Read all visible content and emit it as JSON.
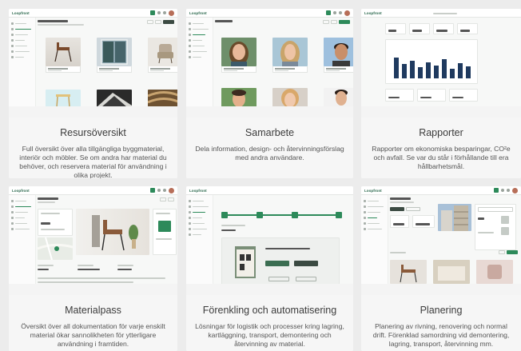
{
  "cards": [
    {
      "title": "Resursöversikt",
      "desc": "Full översikt över alla tillgängliga byggmaterial, interiör och möbler. Se om andra har material du behöver, och reservera material för användning i olika projekt."
    },
    {
      "title": "Samarbete",
      "desc": "Dela information, design- och återvinningsförslag med andra användare."
    },
    {
      "title": "Rapporter",
      "desc": "Rapporter om ekonomiska besparingar, CO²e och avfall. Se var du står i förhållande till era hållbarhetsmål."
    },
    {
      "title": "Materialpass",
      "desc": "Översikt över all dokumentation för varje enskilt material ökar sannolikheten för ytterligare användning i framtiden."
    },
    {
      "title": "Förenkling och automatisering",
      "desc": "Lösningar för logistik och processer kring lagring, kartläggning, transport, demontering och återvinning av material."
    },
    {
      "title": "Planering",
      "desc": "Planering av rivning, renovering och normal drift. Förenklad samordning vid demontering, lagring, transport, återvinning mm."
    }
  ],
  "app": {
    "logo": "Loopfront"
  },
  "colors": {
    "brand": "#2d8a5a",
    "bars": "#1f3a5f",
    "card_bg": "#f6f6f6",
    "page_bg": "#ececec"
  },
  "icons": [
    "logo-icon",
    "notification-icon",
    "settings-icon",
    "avatar"
  ]
}
